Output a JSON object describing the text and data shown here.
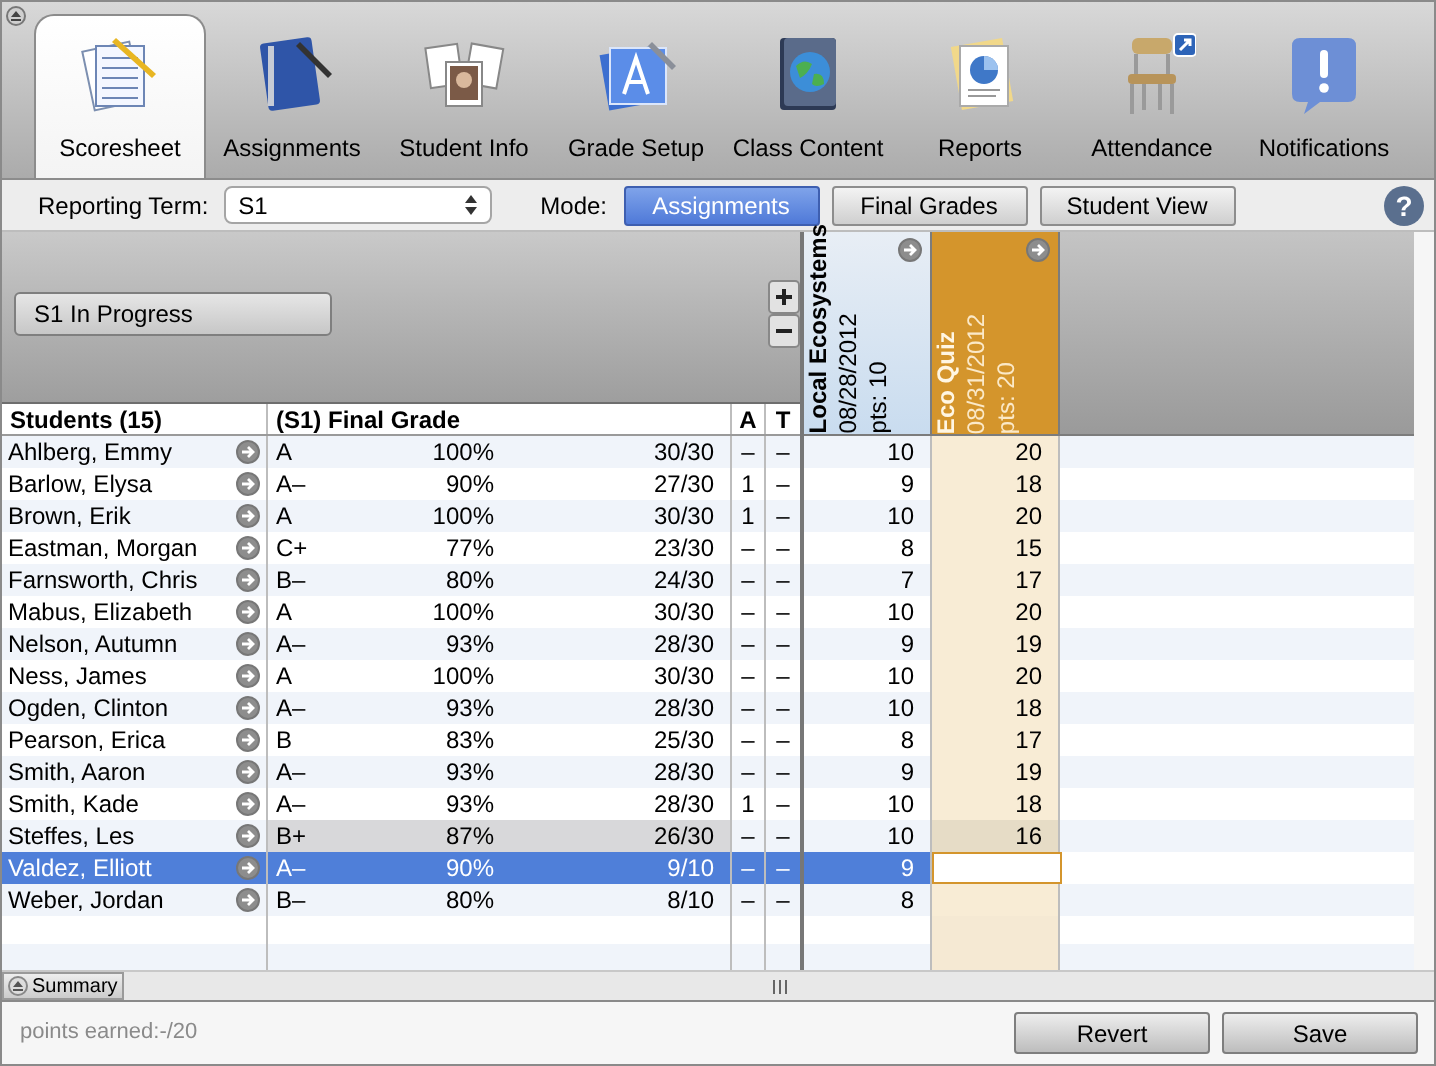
{
  "toolbar": {
    "tabs": [
      {
        "label": "Scoresheet",
        "selected": true
      },
      {
        "label": "Assignments",
        "selected": false
      },
      {
        "label": "Student Info",
        "selected": false
      },
      {
        "label": "Grade Setup",
        "selected": false
      },
      {
        "label": "Class Content",
        "selected": false
      },
      {
        "label": "Reports",
        "selected": false
      },
      {
        "label": "Attendance",
        "selected": false
      },
      {
        "label": "Notifications",
        "selected": false
      }
    ]
  },
  "mode_bar": {
    "reporting_term_label": "Reporting Term:",
    "reporting_term_value": "S1",
    "mode_label": "Mode:",
    "help": "?",
    "modes": [
      {
        "label": "Assignments",
        "selected": true
      },
      {
        "label": "Final Grades",
        "selected": false
      },
      {
        "label": "Student View",
        "selected": false
      }
    ]
  },
  "progress_button": "S1 In Progress",
  "columns": {
    "students": "Students (15)",
    "final_grade": "(S1) Final Grade",
    "a": "A",
    "t": "T"
  },
  "assignments": [
    {
      "title": "Local Ecosystems",
      "date": "08/28/2012",
      "points": "pts: 10",
      "selected": false
    },
    {
      "title": "Eco Quiz",
      "date": "08/31/2012",
      "points": "pts: 20",
      "selected": true
    }
  ],
  "rows": [
    {
      "name": "Ahlberg, Emmy",
      "grade": "A",
      "percent": "100%",
      "score": "30/30",
      "a": "–",
      "t": "–",
      "scores": [
        "10",
        "20"
      ],
      "selected": false,
      "highlighted": false,
      "editing": false
    },
    {
      "name": "Barlow, Elysa",
      "grade": "A–",
      "percent": "90%",
      "score": "27/30",
      "a": "1",
      "t": "–",
      "scores": [
        "9",
        "18"
      ],
      "selected": false,
      "highlighted": false,
      "editing": false
    },
    {
      "name": "Brown, Erik",
      "grade": "A",
      "percent": "100%",
      "score": "30/30",
      "a": "1",
      "t": "–",
      "scores": [
        "10",
        "20"
      ],
      "selected": false,
      "highlighted": false,
      "editing": false
    },
    {
      "name": "Eastman, Morgan",
      "grade": "C+",
      "percent": "77%",
      "score": "23/30",
      "a": "–",
      "t": "–",
      "scores": [
        "8",
        "15"
      ],
      "selected": false,
      "highlighted": false,
      "editing": false
    },
    {
      "name": "Farnsworth, Chris",
      "grade": "B–",
      "percent": "80%",
      "score": "24/30",
      "a": "–",
      "t": "–",
      "scores": [
        "7",
        "17"
      ],
      "selected": false,
      "highlighted": false,
      "editing": false
    },
    {
      "name": "Mabus, Elizabeth",
      "grade": "A",
      "percent": "100%",
      "score": "30/30",
      "a": "–",
      "t": "–",
      "scores": [
        "10",
        "20"
      ],
      "selected": false,
      "highlighted": false,
      "editing": false
    },
    {
      "name": "Nelson, Autumn",
      "grade": "A–",
      "percent": "93%",
      "score": "28/30",
      "a": "–",
      "t": "–",
      "scores": [
        "9",
        "19"
      ],
      "selected": false,
      "highlighted": false,
      "editing": false
    },
    {
      "name": "Ness, James",
      "grade": "A",
      "percent": "100%",
      "score": "30/30",
      "a": "–",
      "t": "–",
      "scores": [
        "10",
        "20"
      ],
      "selected": false,
      "highlighted": false,
      "editing": false
    },
    {
      "name": "Ogden, Clinton",
      "grade": "A–",
      "percent": "93%",
      "score": "28/30",
      "a": "–",
      "t": "–",
      "scores": [
        "10",
        "18"
      ],
      "selected": false,
      "highlighted": false,
      "editing": false
    },
    {
      "name": "Pearson, Erica",
      "grade": "B",
      "percent": "83%",
      "score": "25/30",
      "a": "–",
      "t": "–",
      "scores": [
        "8",
        "17"
      ],
      "selected": false,
      "highlighted": false,
      "editing": false
    },
    {
      "name": "Smith, Aaron",
      "grade": "A–",
      "percent": "93%",
      "score": "28/30",
      "a": "–",
      "t": "–",
      "scores": [
        "9",
        "19"
      ],
      "selected": false,
      "highlighted": false,
      "editing": false
    },
    {
      "name": "Smith, Kade",
      "grade": "A–",
      "percent": "93%",
      "score": "28/30",
      "a": "1",
      "t": "–",
      "scores": [
        "10",
        "18"
      ],
      "selected": false,
      "highlighted": false,
      "editing": false
    },
    {
      "name": "Steffes, Les",
      "grade": "B+",
      "percent": "87%",
      "score": "26/30",
      "a": "–",
      "t": "–",
      "scores": [
        "10",
        "16"
      ],
      "selected": false,
      "highlighted": true,
      "editing": false
    },
    {
      "name": "Valdez, Elliott",
      "grade": "A–",
      "percent": "90%",
      "score": "9/10",
      "a": "–",
      "t": "–",
      "scores": [
        "9"
      ],
      "selected": true,
      "highlighted": false,
      "editing": true
    },
    {
      "name": "Weber, Jordan",
      "grade": "B–",
      "percent": "80%",
      "score": "8/10",
      "a": "–",
      "t": "–",
      "scores": [
        "8"
      ],
      "selected": false,
      "highlighted": false,
      "editing": false
    }
  ],
  "summary_button": "Summary",
  "status": "points earned:-/20",
  "buttons": [
    "Revert",
    "Save"
  ]
}
